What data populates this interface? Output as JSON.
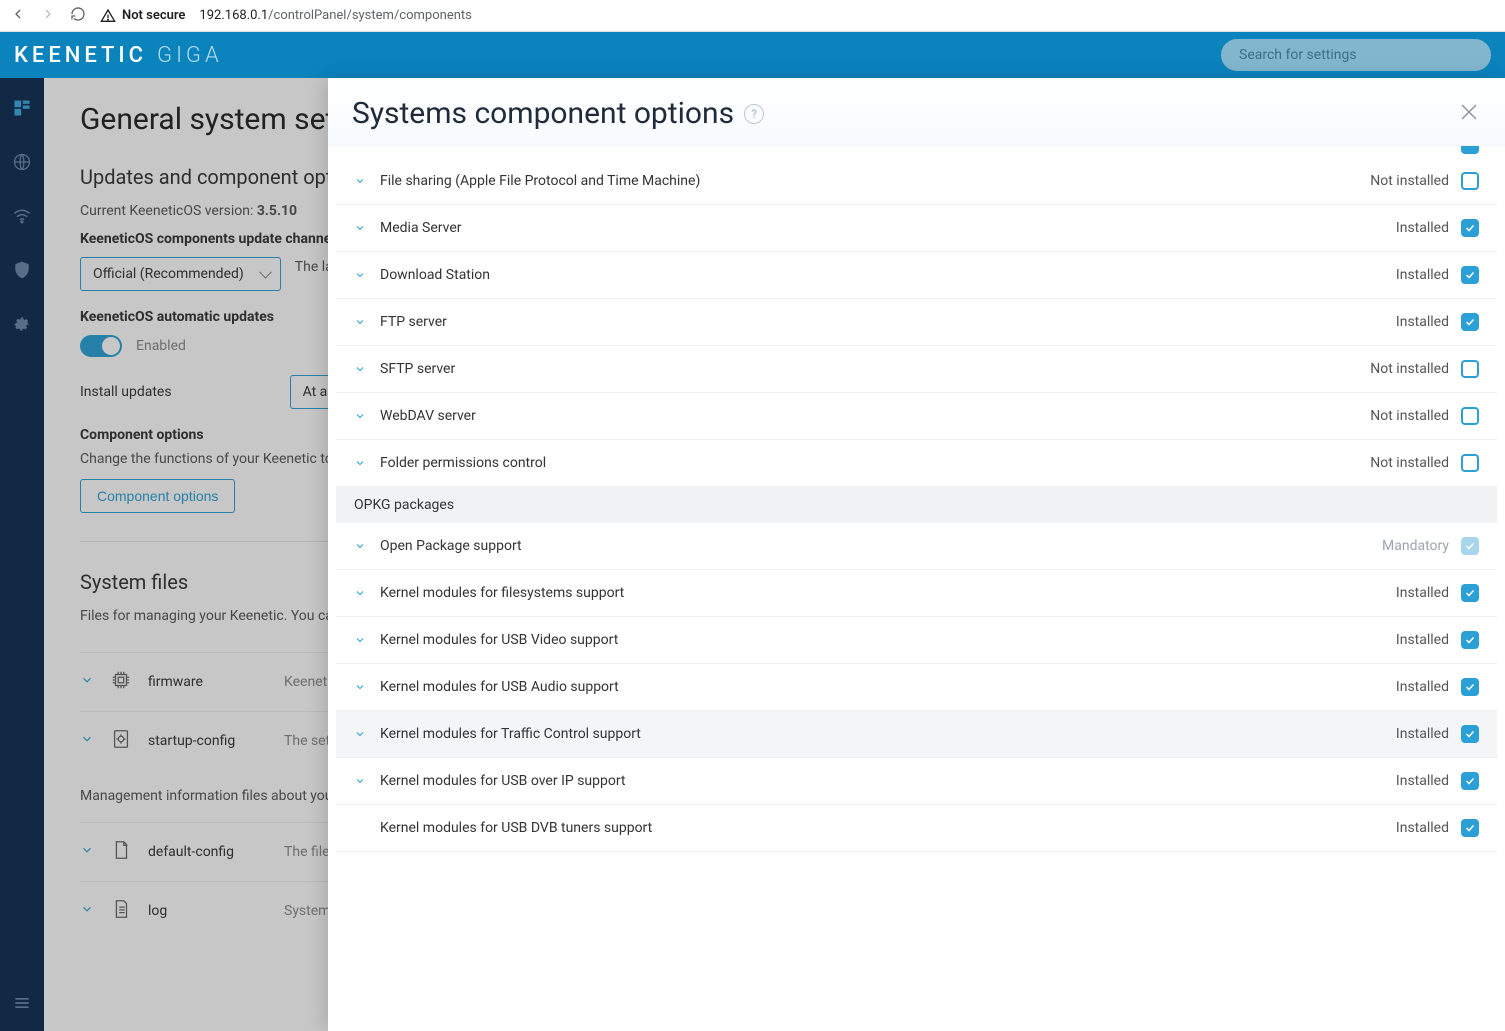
{
  "browser": {
    "not_secure_label": "Not secure",
    "url_host": "192.168.0.1",
    "url_path": "/controlPanel/system/components"
  },
  "header": {
    "brand1": "KEENETIC",
    "brand2": "GIGA",
    "search_placeholder": "Search for settings"
  },
  "page": {
    "title": "General system settings",
    "updates_heading": "Updates and component options",
    "current_version_label": "Current KeeneticOS version:",
    "current_version": "3.5.10",
    "channel_label": "KeeneticOS components update channel",
    "channel_value": "Official (Recommended)",
    "channel_help": "The latest",
    "auto_updates_label": "KeeneticOS automatic updates",
    "auto_updates_state": "Enabled",
    "install_updates_label": "Install updates",
    "install_updates_value": "At any time",
    "component_options_heading": "Component options",
    "component_options_desc": "Change the functions of your Keenetic to suit your",
    "component_options_btn": "Component options",
    "sysfiles_heading": "System files",
    "sysfiles_desc": "Files for managing your Keenetic. You can download",
    "sysfiles_desc2": "Management information files about your device",
    "files": [
      {
        "name": "firmware",
        "desc": "KeeneticOS",
        "icon": "chip"
      },
      {
        "name": "startup-config",
        "desc": "The set of",
        "icon": "gear-doc"
      },
      {
        "name": "default-config",
        "desc": "The file holds",
        "icon": "doc"
      },
      {
        "name": "log",
        "desc": "System events",
        "icon": "doc-lines"
      }
    ]
  },
  "panel": {
    "title": "Systems component options",
    "group_label": "OPKG packages",
    "rows": [
      {
        "name": "File sharing (Apple File Protocol and Time Machine)",
        "status": "Not installed",
        "checked": false,
        "chev": true
      },
      {
        "name": "Media Server",
        "status": "Installed",
        "checked": true,
        "chev": true
      },
      {
        "name": "Download Station",
        "status": "Installed",
        "checked": true,
        "chev": true
      },
      {
        "name": "FTP server",
        "status": "Installed",
        "checked": true,
        "chev": true
      },
      {
        "name": "SFTP server",
        "status": "Not installed",
        "checked": false,
        "chev": true
      },
      {
        "name": "WebDAV server",
        "status": "Not installed",
        "checked": false,
        "chev": true
      },
      {
        "name": "Folder permissions control",
        "status": "Not installed",
        "checked": false,
        "chev": true
      }
    ],
    "rows2": [
      {
        "name": "Open Package support",
        "status": "Mandatory",
        "checked": true,
        "disabled": true,
        "chev": true,
        "muted": true
      },
      {
        "name": "Kernel modules for filesystems support",
        "status": "Installed",
        "checked": true,
        "chev": true
      },
      {
        "name": "Kernel modules for USB Video support",
        "status": "Installed",
        "checked": true,
        "chev": true
      },
      {
        "name": "Kernel modules for USB Audio support",
        "status": "Installed",
        "checked": true,
        "chev": true
      },
      {
        "name": "Kernel modules for Traffic Control support",
        "status": "Installed",
        "checked": true,
        "chev": true,
        "hover": true
      },
      {
        "name": "Kernel modules for USB over IP support",
        "status": "Installed",
        "checked": true,
        "chev": true
      },
      {
        "name": "Kernel modules for USB DVB tuners support",
        "status": "Installed",
        "checked": true,
        "chev": false
      }
    ]
  }
}
